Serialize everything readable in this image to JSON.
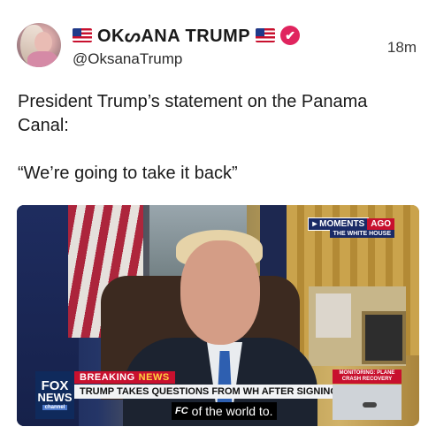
{
  "post": {
    "author": {
      "display_name": "OKᔕANA TRUMP",
      "handle": "@OksanaTrump",
      "verified_badge": "✔",
      "flag_icon": "us-flag-icon"
    },
    "timestamp": "18m",
    "text_lines": [
      "President Trump’s statement on the Panama Canal:",
      "“We’re going to take it back”"
    ],
    "media": {
      "moments_label": "▸ MOMENTS",
      "ago_label": "AGO",
      "location_label": "THE WHITE HOUSE",
      "breaking_label": "BREAKING",
      "breaking_news_label": "NEWS",
      "ticker_text": "TRUMP TAKES QUESTIONS FROM WH AFTER SIGNING ORDERS",
      "network_logo_top": "FOX",
      "network_logo_bottom": "NEWS",
      "network_logo_sub": "channel",
      "monitoring_line1": "MONITORING: PLANE",
      "monitoring_line2": "CRASH RECOVERY",
      "caption_logo": "FC",
      "caption_text": "of the world to."
    }
  }
}
